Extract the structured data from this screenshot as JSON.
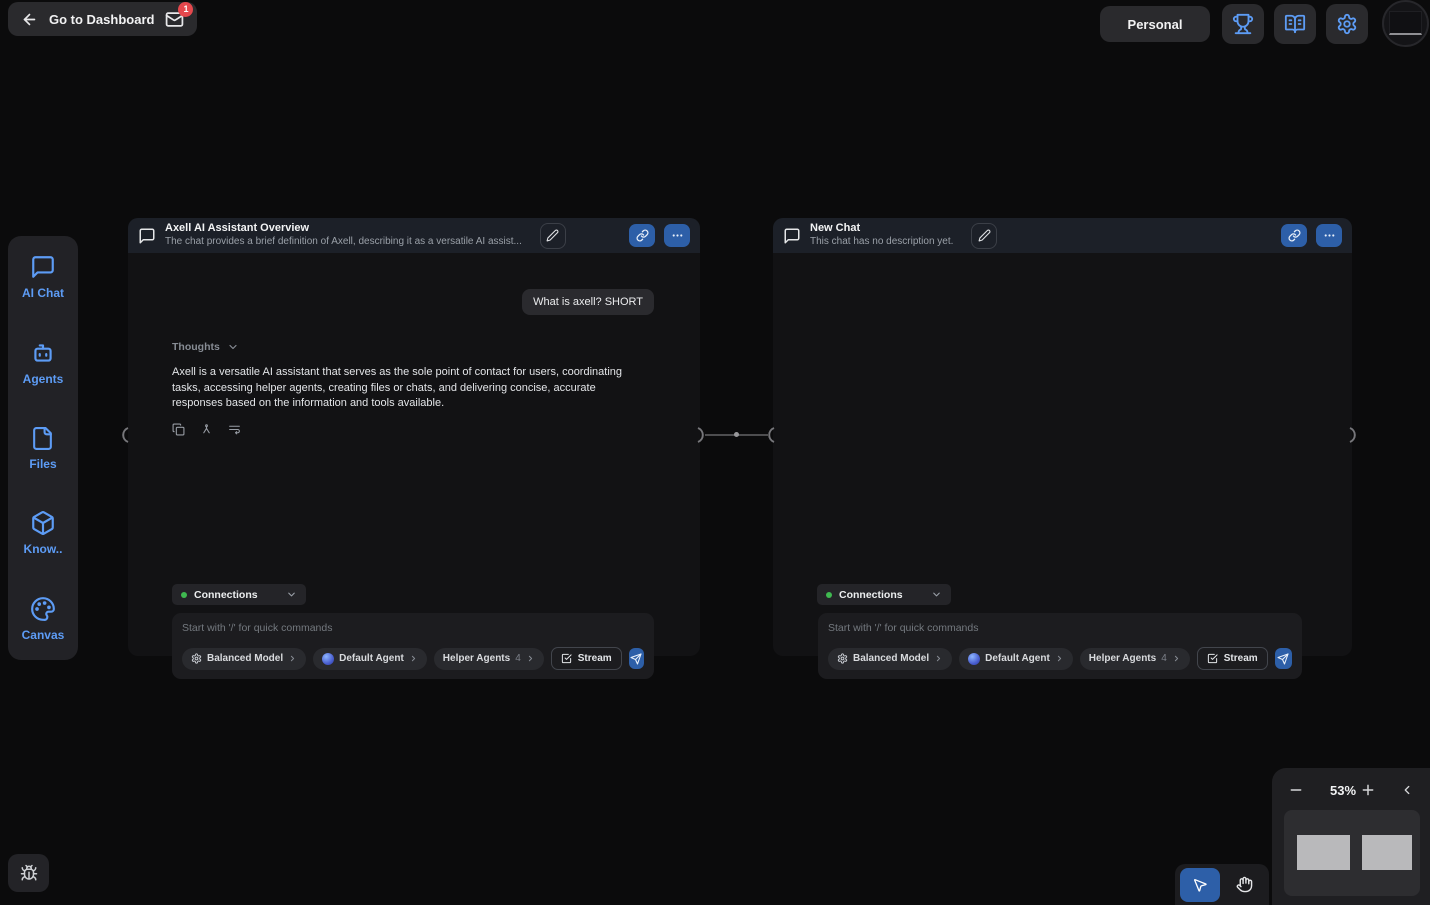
{
  "topbar": {
    "back_label": "Go to Dashboard",
    "mail_badge": "1",
    "personal_label": "Personal"
  },
  "sidebar": {
    "items": [
      {
        "label": "AI Chat"
      },
      {
        "label": "Agents"
      },
      {
        "label": "Files"
      },
      {
        "label": "Know.."
      },
      {
        "label": "Canvas"
      }
    ]
  },
  "cards": [
    {
      "title": "Axell AI Assistant Overview",
      "description": "The chat provides a brief definition of Axell, describing it as a versatile AI assist...",
      "user_message": "What is axell? SHORT",
      "thoughts_label": "Thoughts",
      "assistant_message": "Axell is a versatile AI assistant that serves as the sole point of contact for users, coordinating tasks, accessing helper agents, creating files or chats, and delivering concise, accurate responses based on the information and tools available."
    },
    {
      "title": "New Chat",
      "description": "This chat has no description yet."
    }
  ],
  "composer": {
    "connections_label": "Connections",
    "placeholder": "Start with '/' for quick commands",
    "model_pill": "Balanced Model",
    "agent_pill": "Default Agent",
    "helper_pill": "Helper Agents",
    "helper_count": "4",
    "stream_label": "Stream"
  },
  "zoom_controls": {
    "zoom_level": "53%"
  },
  "colors": {
    "accent_blue": "#5d9cf5",
    "button_blue": "#2d5fa8",
    "badge_red": "#e5484d",
    "green_dot": "#3fb950"
  }
}
